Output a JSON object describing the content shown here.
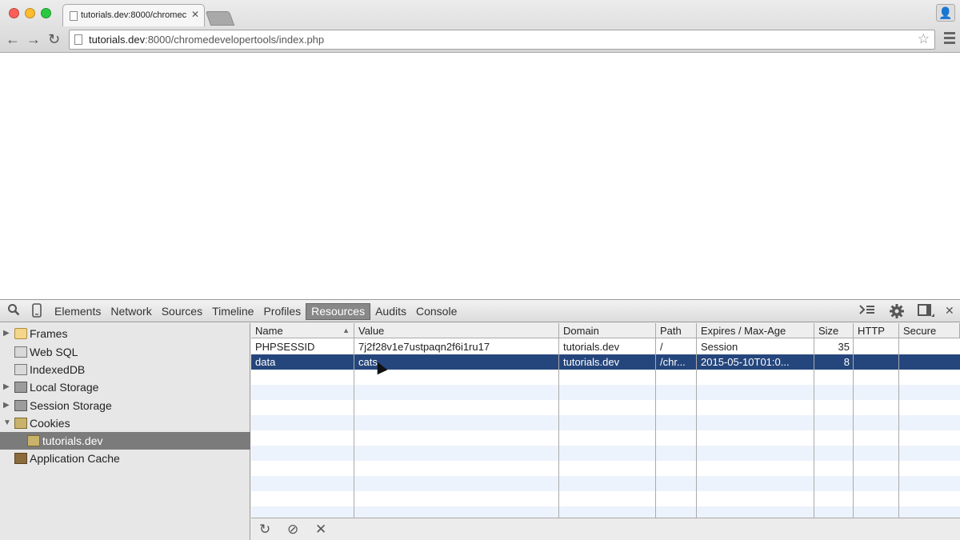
{
  "browser": {
    "tab_title": "tutorials.dev:8000/chromec",
    "tab_close": "✕",
    "url_host": "tutorials.dev",
    "url_path": ":8000/chromedevelopertools/index.php",
    "star_icon": "☆",
    "back_icon": "←",
    "forward_icon": "→",
    "reload_icon": "↻",
    "profile_icon": "👤"
  },
  "devtools": {
    "tabs": [
      "Elements",
      "Network",
      "Sources",
      "Timeline",
      "Profiles",
      "Resources",
      "Audits",
      "Console"
    ],
    "active_tab": "Resources",
    "sidebar": [
      {
        "label": "Frames",
        "icon": "folder-icon",
        "arrow": "▶"
      },
      {
        "label": "Web SQL",
        "icon": "database-icon",
        "arrow": ""
      },
      {
        "label": "IndexedDB",
        "icon": "database-icon",
        "arrow": ""
      },
      {
        "label": "Local Storage",
        "icon": "grid-icon",
        "arrow": "▶"
      },
      {
        "label": "Session Storage",
        "icon": "grid-icon",
        "arrow": "▶"
      },
      {
        "label": "Cookies",
        "icon": "cookie-icon",
        "arrow": "▼"
      },
      {
        "label": "tutorials.dev",
        "icon": "cookie-icon",
        "arrow": ""
      },
      {
        "label": "Application Cache",
        "icon": "cache-icon",
        "arrow": ""
      }
    ],
    "selected_sidebar_item": "tutorials.dev",
    "columns": [
      "Name",
      "Value",
      "Domain",
      "Path",
      "Expires / Max-Age",
      "Size",
      "HTTP",
      "Secure"
    ],
    "rows": [
      {
        "name": "PHPSESSID",
        "value": "7j2f28v1e7ustpaqn2f6i1ru17",
        "domain": "tutorials.dev",
        "path": "/",
        "expires": "Session",
        "size": "35",
        "http": "",
        "secure": ""
      },
      {
        "name": "data",
        "value": "cats",
        "domain": "tutorials.dev",
        "path": "/chr...",
        "expires": "2015-05-10T01:0...",
        "size": "8",
        "http": "",
        "secure": ""
      }
    ],
    "selected_row": "data",
    "bottom_buttons": {
      "refresh": "↻",
      "clear": "⊘",
      "delete": "✕"
    }
  }
}
